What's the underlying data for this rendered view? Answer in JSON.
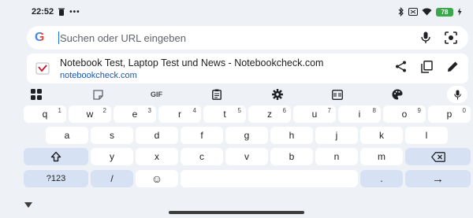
{
  "status_bar": {
    "time": "22:52",
    "battery_level": "78"
  },
  "search": {
    "placeholder": "Suchen oder URL eingeben"
  },
  "suggestion": {
    "title": "Notebook Test, Laptop Test und News - Notebookcheck.com",
    "url": "notebookcheck.com"
  },
  "toolbar": {
    "gif_label": "GIF"
  },
  "keyboard": {
    "row1": [
      {
        "label": "q",
        "sup": "1"
      },
      {
        "label": "w",
        "sup": "2"
      },
      {
        "label": "e",
        "sup": "3"
      },
      {
        "label": "r",
        "sup": "4"
      },
      {
        "label": "t",
        "sup": "5"
      },
      {
        "label": "z",
        "sup": "6"
      },
      {
        "label": "u",
        "sup": "7"
      },
      {
        "label": "i",
        "sup": "8"
      },
      {
        "label": "o",
        "sup": "9"
      },
      {
        "label": "p",
        "sup": "0"
      }
    ],
    "row2": [
      "a",
      "s",
      "d",
      "f",
      "g",
      "h",
      "j",
      "k",
      "l"
    ],
    "row3": [
      "y",
      "x",
      "c",
      "v",
      "b",
      "n",
      "m"
    ],
    "symbols_label": "?123",
    "slash_label": "/",
    "period_label": ".",
    "emoji_glyph": "☺",
    "enter_glyph": "→"
  },
  "colors": {
    "accent": "#1a73e8",
    "link": "#1a57b8",
    "key_special": "#d6e2f3",
    "background": "#eef1f6"
  }
}
